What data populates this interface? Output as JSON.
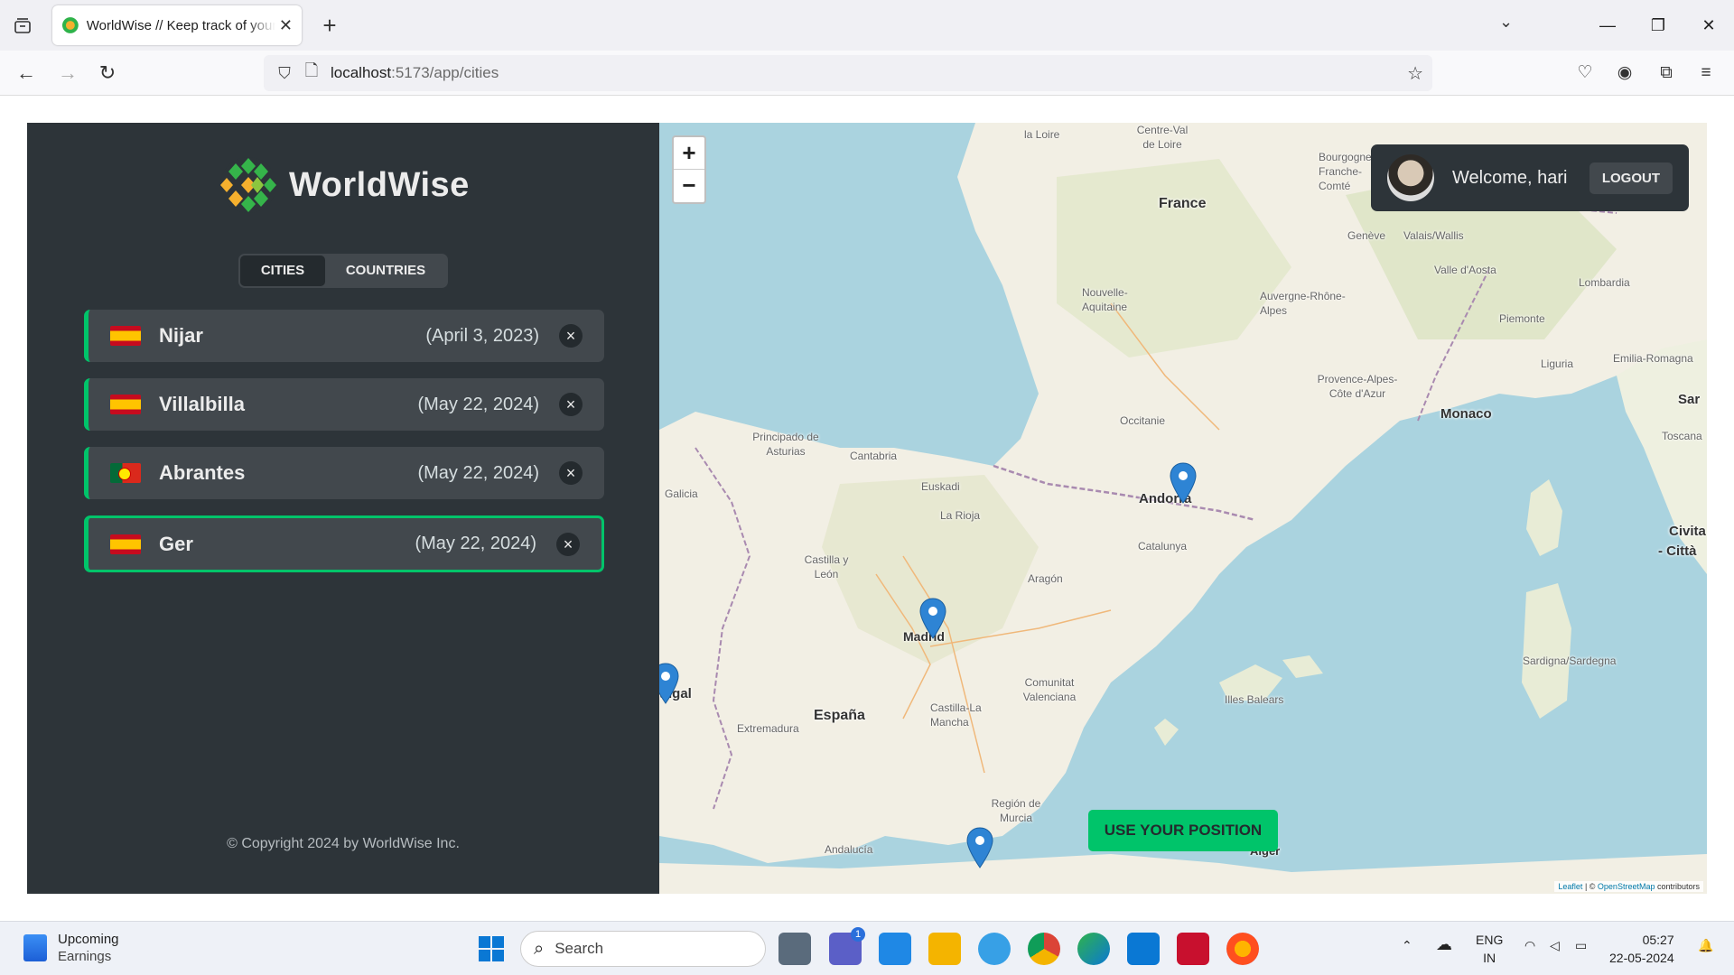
{
  "browser": {
    "tab_title": "WorldWise // Keep track of your adventures",
    "url_host": "localhost",
    "url_path": ":5173/app/cities"
  },
  "app": {
    "logo_text": "WorldWise",
    "tabs": {
      "cities": "CITIES",
      "countries": "COUNTRIES"
    },
    "cities": [
      {
        "flag": "es",
        "name": "Nijar",
        "date": "(April 3, 2023)",
        "active": false
      },
      {
        "flag": "es",
        "name": "Villalbilla",
        "date": "(May 22, 2024)",
        "active": false
      },
      {
        "flag": "pt",
        "name": "Abrantes",
        "date": "(May 22, 2024)",
        "active": false
      },
      {
        "flag": "es",
        "name": "Ger",
        "date": "(May 22, 2024)",
        "active": true
      }
    ],
    "delete_glyph": "×",
    "copyright": "© Copyright 2024 by WorldWise Inc."
  },
  "map": {
    "zoom_in": "+",
    "zoom_out": "−",
    "welcome": "Welcome, hari",
    "logout": "LOGOUT",
    "use_position": "USE YOUR POSITION",
    "attribution_leaflet": "Leaflet",
    "attribution_sep": " | © ",
    "attribution_osm": "OpenStreetMap",
    "attribution_tail": " contributors",
    "labels": {
      "france": "France",
      "espana": "España",
      "madrid": "Madrid",
      "andorra": "Andorra",
      "monaco": "Monaco",
      "portugal": "tugal",
      "alger": "Alger",
      "civita": "Civita",
      "citta": "- Città",
      "catalunya": "Catalunya",
      "aragon": "Aragón",
      "occitanie": "Occitanie",
      "nouvelle": "Nouvelle-Aquitaine",
      "auvergne": "Auvergne-Rhône-Alpes",
      "castilla_mancha": "Castilla-La Mancha",
      "extremadura": "Extremadura",
      "andalucia": "Andalucía",
      "galicia": "Galicia",
      "cantabria": "Cantabria",
      "asturias": "Principado de Asturias",
      "rioja": "La Rioja",
      "valencia": "Comunitat Valenciana",
      "murcia": "Región de Murcia",
      "illes": "Illes Balears",
      "sardegna": "Sardigna/Sardegna",
      "provence": "Provence-Alpes-Côte d'Azur",
      "piemonte": "Piemonte",
      "lombardia": "Lombardia",
      "liguria": "Liguria",
      "emilia": "Emilia-Romagna",
      "toscana": "Toscana",
      "valais": "Valais/Wallis",
      "aosta": "Valle d'Aosta",
      "bourgogne": "Bourgogne-Franche-Comté",
      "loire": "la Loire",
      "centre": "Centre-Val de Loire",
      "geneve": "Genève",
      "castilla_leon": "Castilla y León",
      "euskadi": "Euskadi",
      "sar": "Sar"
    }
  },
  "taskbar": {
    "weather_title": "Upcoming",
    "weather_sub": "Earnings",
    "search_placeholder": "Search",
    "lang": "ENG",
    "lang_region": "IN",
    "time": "05:27",
    "date": "22-05-2024",
    "teams_badge": "1"
  }
}
